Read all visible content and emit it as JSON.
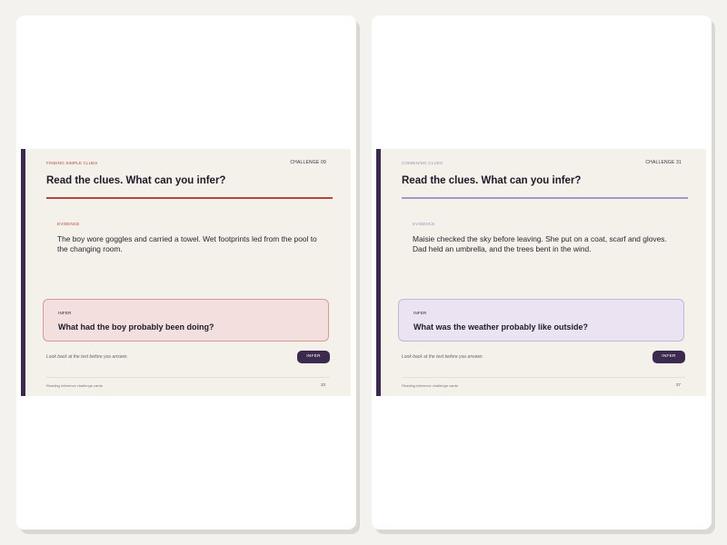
{
  "pages": [
    {
      "eyebrow": "FINDING SIMPLE CLUES",
      "challenge": "CHALLENGE 09",
      "title": "Read the clues. What can you infer?",
      "evidence_label": "EVIDENCE",
      "evidence_text": "The boy wore goggles and carried a towel. Wet footprints led from the pool to the changing room.",
      "infer_label": "INFER",
      "question": "What had the boy probably been doing?",
      "hint": "Look back at the text before you answer.",
      "button_label": "INFER",
      "footer_left": "Reading Inference challenge cards",
      "footer_right": "33"
    },
    {
      "eyebrow": "COMBINING CLUES",
      "challenge": "CHALLENGE 31",
      "title": "Read the clues. What can you infer?",
      "evidence_label": "EVIDENCE",
      "evidence_text": "Maisie checked the sky before leaving. She put on a coat, scarf and gloves. Dad held an umbrella, and the trees bent in the wind.",
      "infer_label": "INFER",
      "question": "What was the weather probably like outside?",
      "hint": "Look back at the text before you answer.",
      "button_label": "INFER",
      "footer_left": "Reading Inference challenge cards",
      "footer_right": "37"
    }
  ]
}
